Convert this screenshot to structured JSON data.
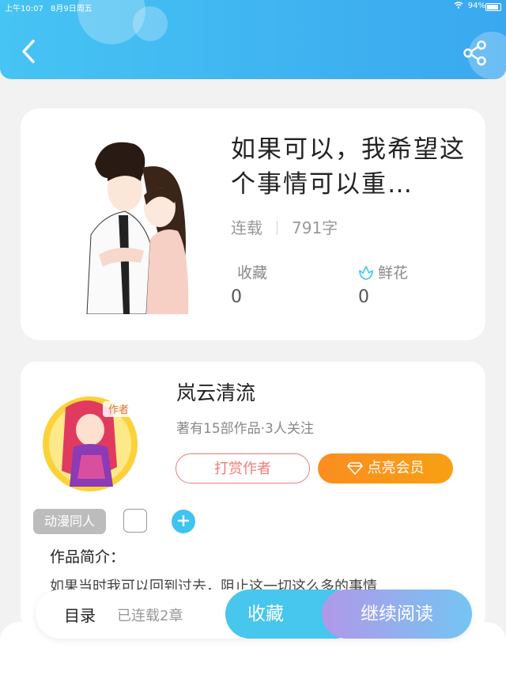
{
  "status_bar": {
    "time": "上午10:07",
    "date": "8月9日周五",
    "battery": "94%"
  },
  "header": {
    "back_icon": "chevron-left-icon",
    "share_icon": "share-icon"
  },
  "book": {
    "title": "如果可以，我希望这个事情可以重…",
    "status": "连载",
    "word_count": "791字",
    "favorites_label": "收藏",
    "favorites_value": "0",
    "flowers_label": "鲜花",
    "flowers_value": "0"
  },
  "author": {
    "name": "岚云清流",
    "stats": "著有15部作品·3人关注",
    "avatar_badge": "作者",
    "tip_label": "打赏作者",
    "vip_label": "点亮会员"
  },
  "tags": {
    "tag1": "动漫同人"
  },
  "intro": {
    "heading": "作品简介：",
    "text": "如果当时我可以回到过去，阻止这一切这么多的事情"
  },
  "bottom": {
    "toc_label": "目录",
    "chapters": "已连载2章",
    "fav_label": "收藏",
    "read_label": "继续阅读"
  },
  "colors": {
    "accent": "#46c4f3",
    "vip_orange": "#fb8d1f",
    "tip_red": "#f07c7c"
  }
}
